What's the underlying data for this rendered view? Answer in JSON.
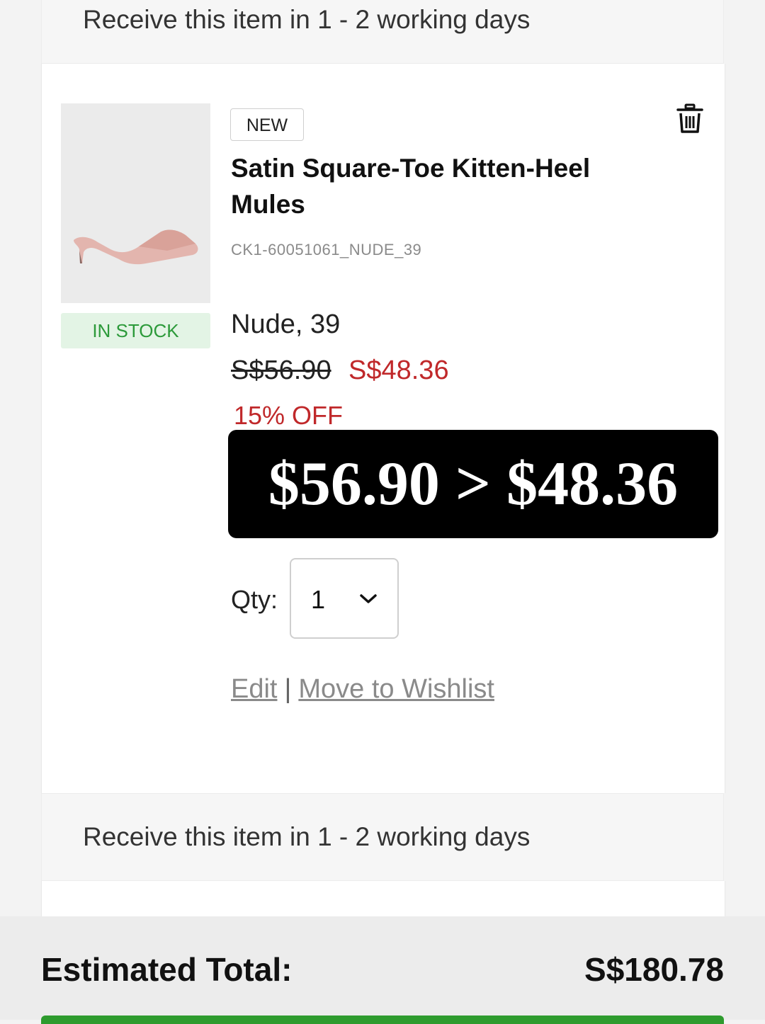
{
  "delivery_notice_top": "Receive this item in 1 - 2 working days",
  "product": {
    "badge": "NEW",
    "name": "Satin Square-Toe Kitten-Heel Mules",
    "sku": "CK1-60051061_NUDE_39",
    "stock_status": "IN STOCK",
    "variant": "Nude, 39",
    "original_price": "S$56.90",
    "sale_price": "S$48.36",
    "discount": "15% OFF",
    "image_icon": "shoe-icon"
  },
  "overlay_caption": "$56.90 > $48.36",
  "quantity": {
    "label": "Qty:",
    "value": "1"
  },
  "actions": {
    "edit": "Edit",
    "separator": "|",
    "wishlist": "Move to Wishlist",
    "delete_icon": "trash-icon"
  },
  "delivery_notice_bottom": "Receive this item in 1 - 2 working days",
  "summary": {
    "total_label": "Estimated Total:",
    "total_value": "S$180.78"
  },
  "colors": {
    "sale_red": "#c0282a",
    "stock_green": "#2c9a3a",
    "checkout_green": "#2e9b2e"
  }
}
